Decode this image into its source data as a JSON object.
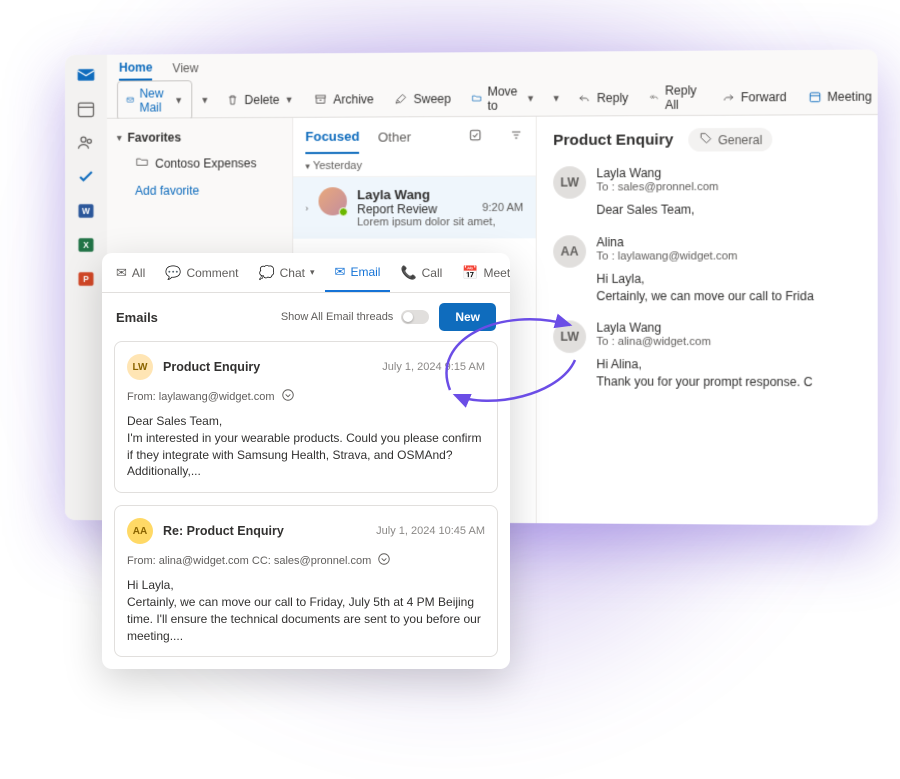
{
  "ribbon": {
    "tabs": {
      "home": "Home",
      "view": "View"
    },
    "new_mail": "New Mail",
    "delete": "Delete",
    "archive": "Archive",
    "sweep": "Sweep",
    "move_to": "Move to",
    "reply": "Reply",
    "reply_all": "Reply All",
    "forward": "Forward",
    "meeting": "Meeting"
  },
  "nav": {
    "favorites": "Favorites",
    "folder1": "Contoso Expenses",
    "add_favorite": "Add favorite"
  },
  "msglist": {
    "focused": "Focused",
    "other": "Other",
    "group_yesterday": "Yesterday",
    "item1": {
      "sender": "Layla Wang",
      "subject": "Report Review",
      "preview": "Lorem ipsum dolor sit amet,",
      "time": "9:20 AM"
    }
  },
  "reading": {
    "subject": "Product Enquiry",
    "badge": "General",
    "m1": {
      "initials": "LW",
      "from": "Layla Wang",
      "to": "To : sales@pronnel.com",
      "body": "Dear Sales Team,"
    },
    "m2": {
      "initials": "AA",
      "from": "Alina",
      "to": "To : laylawang@widget.com",
      "body1": "Hi Layla,",
      "body2": "Certainly, we can move our call to Frida"
    },
    "m3": {
      "initials": "LW",
      "from": "Layla Wang",
      "to": "To : alina@widget.com",
      "body1": "Hi Alina,",
      "body2": "Thank you for your prompt response. C"
    }
  },
  "card": {
    "tabs": {
      "all": "All",
      "comment": "Comment",
      "chat": "Chat",
      "email": "Email",
      "call": "Call",
      "meeting": "Meeting"
    },
    "title": "Emails",
    "show_all": "Show All Email threads",
    "new": "New",
    "t1": {
      "initials": "LW",
      "subject": "Product Enquiry",
      "date": "July 1, 2024 9:15 AM",
      "from": "From: laylawang@widget.com",
      "body": "Dear Sales Team,\nI'm interested in your wearable products. Could you please confirm if they integrate with Samsung Health, Strava, and OSMAnd? Additionally,..."
    },
    "t2": {
      "initials": "AA",
      "subject": "Re: Product Enquiry",
      "date": "July 1, 2024 10:45 AM",
      "from": "From: alina@widget.com   CC: sales@pronnel.com",
      "body": "Hi Layla,\nCertainly, we can move our call to Friday, July 5th at 4 PM Beijing time. I'll ensure the technical documents are sent to you before our meeting...."
    }
  }
}
